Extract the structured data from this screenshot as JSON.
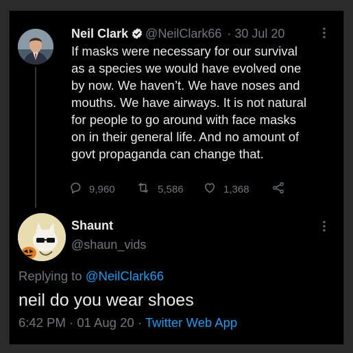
{
  "colors": {
    "background": "#000000",
    "text": "#e7e9ea",
    "muted": "#71767b",
    "accent": "#1d9bf0"
  },
  "parent_tweet": {
    "display_name": "Neil Clark",
    "verified_icon": "verified-badge-icon",
    "handle": "@NeilClark66",
    "separator": "·",
    "date": "30 Jul 20",
    "lines": [
      "If masks were necessary for our survival",
      "as a species we would have evolved one",
      "by now. We haven’t. We have noses and",
      "mouths. We have airways. It is not natural",
      "for people to go around with face masks",
      "on in their general life. And no amount of",
      "govt propaganda can change that."
    ],
    "actions": {
      "replies": "9,960",
      "retweets": "5,586",
      "likes": "1,368"
    }
  },
  "reply_tweet": {
    "display_name": "Shaunt",
    "handle": "@shaun_vids",
    "replying_prefix": "Replying to",
    "replying_to": "@NeilClark66",
    "text": "neil do you wear shoes",
    "time": "6:42 PM",
    "separator": "·",
    "date": "01 Aug 20",
    "source": "Twitter Web App"
  }
}
